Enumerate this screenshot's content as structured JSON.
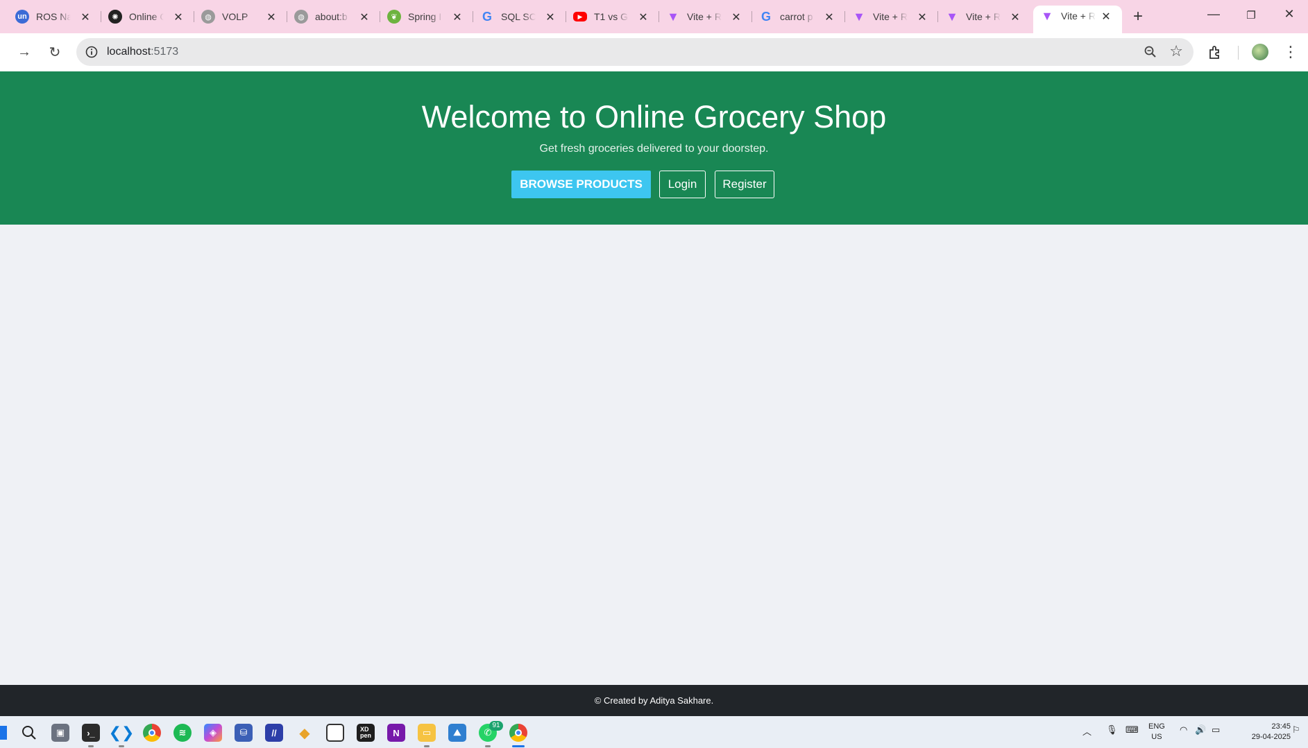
{
  "browser": {
    "tabs": [
      {
        "title": "ROS Na",
        "favicon": "un",
        "favicon_color": "#3b6bd6"
      },
      {
        "title": "Online G",
        "favicon": "openai-icon",
        "favicon_color": "#222222"
      },
      {
        "title": "VOLP",
        "favicon": "globe-icon",
        "favicon_color": "#8a8a8a"
      },
      {
        "title": "about:b",
        "favicon": "globe-icon",
        "favicon_color": "#8a8a8a"
      },
      {
        "title": "Spring I",
        "favicon": "spring-icon",
        "favicon_color": "#6db33f"
      },
      {
        "title": "SQL SC",
        "favicon": "google-icon",
        "favicon_color": "#4285f4"
      },
      {
        "title": "T1 vs G",
        "favicon": "youtube-icon",
        "favicon_color": "#ff0000"
      },
      {
        "title": "Vite + R",
        "favicon": "vite-icon",
        "favicon_color": "#a855f7"
      },
      {
        "title": "carrot p",
        "favicon": "google-icon",
        "favicon_color": "#4285f4"
      },
      {
        "title": "Vite + R",
        "favicon": "vite-icon",
        "favicon_color": "#a855f7"
      },
      {
        "title": "Vite + R",
        "favicon": "vite-icon",
        "favicon_color": "#a855f7"
      },
      {
        "title": "Vite + R",
        "favicon": "vite-icon",
        "favicon_color": "#a855f7",
        "active": true
      }
    ],
    "url_host": "localhost",
    "url_port": ":5173",
    "tabstrip_color": "#f8d5e6"
  },
  "hero": {
    "title": "Welcome to Online Grocery Shop",
    "subtitle": "Get fresh groceries delivered to your doorstep.",
    "browse_label": "BROWSE PRODUCTS",
    "login_label": "Login",
    "register_label": "Register",
    "background_color": "#198754",
    "browse_color": "#3dc6f0"
  },
  "footer": {
    "text": "© Created by Aditya Sakhare."
  },
  "taskbar": {
    "whatsapp_badge": "91",
    "lang_1": "ENG",
    "lang_2": "US",
    "time": "23:45",
    "date": "29-04-2025"
  }
}
